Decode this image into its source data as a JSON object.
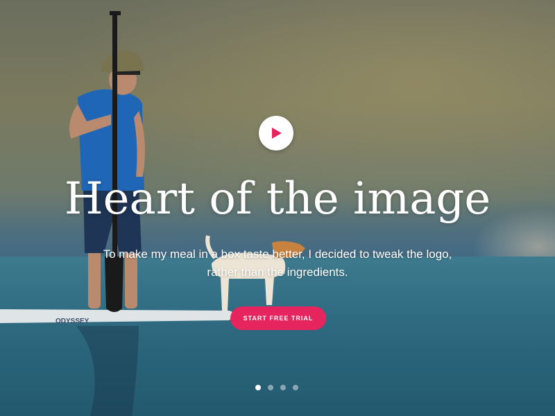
{
  "hero": {
    "headline": "Heart of the image",
    "subtitle_line1": "To make my meal in a box taste better, I decided to tweak the logo,",
    "subtitle_line2": "rather than the ingredients.",
    "cta_label": "START FREE TRIAL",
    "board_text": "ODYSSEY",
    "accent_color": "#e6245e"
  },
  "play_button": {
    "icon": "play-icon"
  },
  "carousel": {
    "slide_count": 4,
    "active_index": 0
  }
}
